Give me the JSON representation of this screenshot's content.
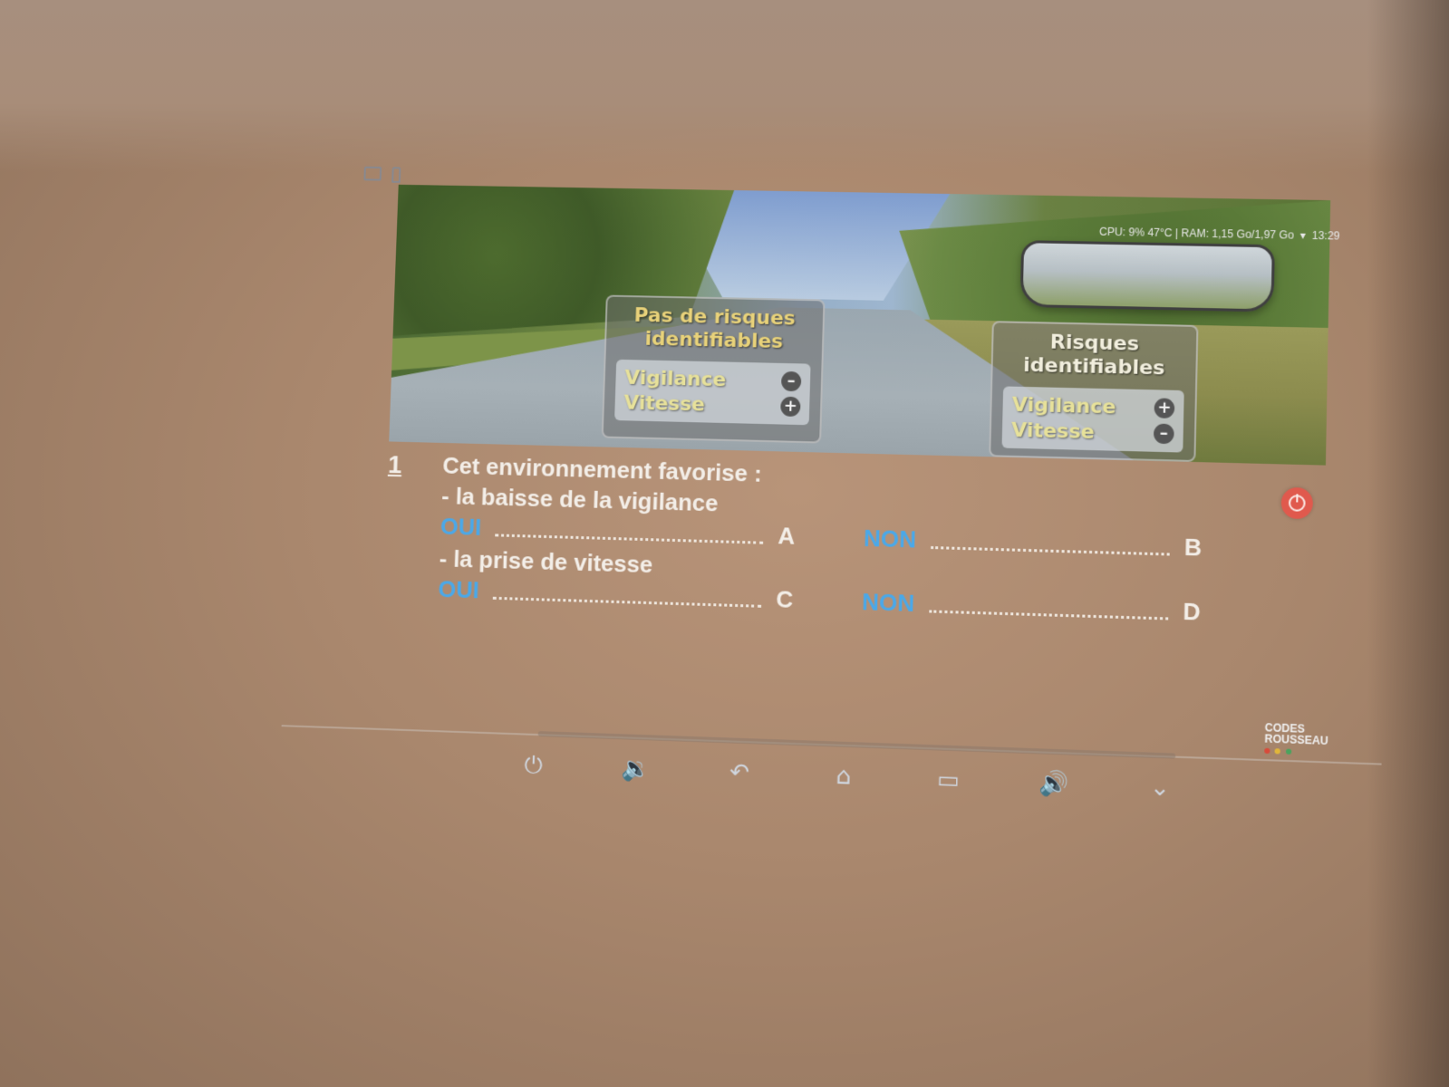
{
  "status_bar": {
    "text": "CPU:  9%  47°C | RAM: 1,15 Go/1,97 Go",
    "time": "13:29"
  },
  "scene": {
    "left_box": {
      "title_line1": "Pas de risques",
      "title_line2": "identifiables",
      "vigilance_label": "Vigilance",
      "vitesse_label": "Vitesse",
      "vigilance_sign": "–",
      "vitesse_sign": "+"
    },
    "right_box": {
      "title_line1": "Risques",
      "title_line2": "identifiables",
      "vigilance_label": "Vigilance",
      "vitesse_label": "Vitesse",
      "vigilance_sign": "+",
      "vitesse_sign": "–"
    }
  },
  "question": {
    "number": "1",
    "line1": "Cet environnement favorise :",
    "line2": "- la baisse de la vigilance",
    "line3": "- la prise de vitesse",
    "answers": [
      {
        "word": "OUI",
        "letter": "A"
      },
      {
        "word": "NON",
        "letter": "B"
      },
      {
        "word": "OUI",
        "letter": "C"
      },
      {
        "word": "NON",
        "letter": "D"
      }
    ]
  },
  "brand": {
    "line1": "CODES",
    "line2": "ROUSSEAU",
    "dot_colors": [
      "#d84a3a",
      "#e1b63a",
      "#4aa35d"
    ]
  },
  "nav_icons": [
    "power-icon",
    "volume-down-icon",
    "back-icon",
    "home-icon",
    "recent-apps-icon",
    "volume-up-icon",
    "collapse-icon"
  ]
}
